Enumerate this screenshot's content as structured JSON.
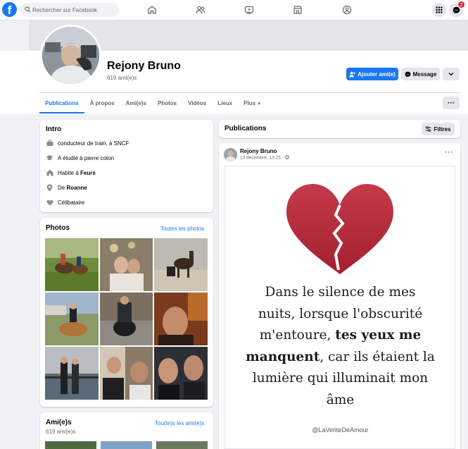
{
  "topbar": {
    "logo": "f",
    "search_placeholder": "Rechercher sur Facebook",
    "nav_icons": [
      "home-icon",
      "friends-icon",
      "watch-icon",
      "marketplace-icon",
      "groups-icon"
    ],
    "notification_count": "2"
  },
  "profile": {
    "name": "Rejony Bruno",
    "friends": "619 ami(e)s",
    "add_friend_label": "Ajouter ami(e)",
    "message_label": "Message"
  },
  "tabs": [
    {
      "label": "Publications",
      "active": true
    },
    {
      "label": "À propos"
    },
    {
      "label": "Ami(e)s"
    },
    {
      "label": "Photos"
    },
    {
      "label": "Vidéos"
    },
    {
      "label": "Lieux"
    },
    {
      "label": "Plus"
    }
  ],
  "tab_more_btn": "···",
  "intro": {
    "title": "Intro",
    "job": "conducteur de train, à SNCF",
    "studied": "A étudié à pierre coton",
    "lives_prefix": "Habite à ",
    "lives_city": "Feurs",
    "from_prefix": "De ",
    "from_city": "Roanne",
    "status": "Célibataire"
  },
  "photos": {
    "title": "Photos",
    "see_all": "Toutes les photos"
  },
  "friends_card": {
    "title": "Ami(e)s",
    "count": "619 ami(e)s",
    "see_all": "Tou(te)s les ami(e)s"
  },
  "posts_header": {
    "title": "Publications",
    "filters_label": "Filtres"
  },
  "post": {
    "author": "Rejony Bruno",
    "date": "13 décembre, 13:25 · ",
    "menu": "···",
    "quote_line1": "Dans le silence de mes",
    "quote_line2": "nuits, lorsque l'obscurité",
    "quote_line3_a": "m'entoure, ",
    "quote_line3_b": "tes yeux me",
    "quote_line4_a": "manquent",
    "quote_line4_b": ", car ils étaient la",
    "quote_line5": "lumière qui illuminait mon",
    "quote_line6": "âme",
    "signature": "@LaVeriteDeAmour"
  },
  "colors": {
    "brand": "#1877f2",
    "heart": "#b8293a",
    "badge": "#e41e3f"
  }
}
